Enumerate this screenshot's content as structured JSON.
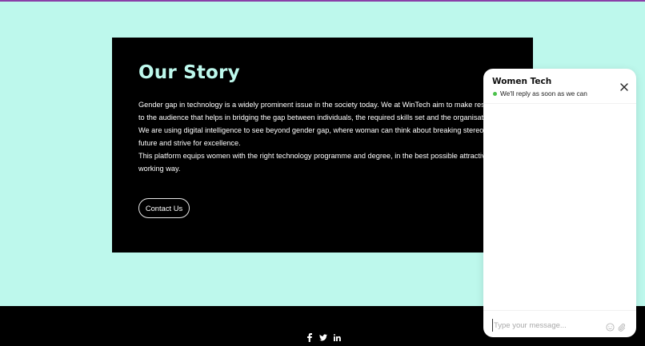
{
  "story": {
    "title": "Our Story",
    "paragraph_lines": [
      "Gender gap in technology is a widely prominent issue in the society today. We at WinTech aim to make resources av",
      "to the audience that helps in bridging the gap between individuals, the required skills set and the organisation role.",
      "We are using digital intelligence to see beyond gender gap, where woman can think about breaking stereotypes, rein",
      "future and strive for excellence.",
      "This platform equips women with the right technology programme and degree, in the best possible attractive, inclusiv",
      "working way."
    ],
    "contact_label": "Contact Us"
  },
  "footer": {
    "social_icons": [
      "facebook-icon",
      "twitter-icon",
      "linkedin-icon"
    ]
  },
  "chat": {
    "title": "Women Tech",
    "status": "We'll reply as soon as we can",
    "input_placeholder": "Type your message...",
    "status_color": "#4cc24c"
  },
  "colors": {
    "page_background": "#bdf8ec",
    "card_background": "#000000",
    "title_color": "#bdf8ec",
    "top_line": "#8a3fa8"
  }
}
